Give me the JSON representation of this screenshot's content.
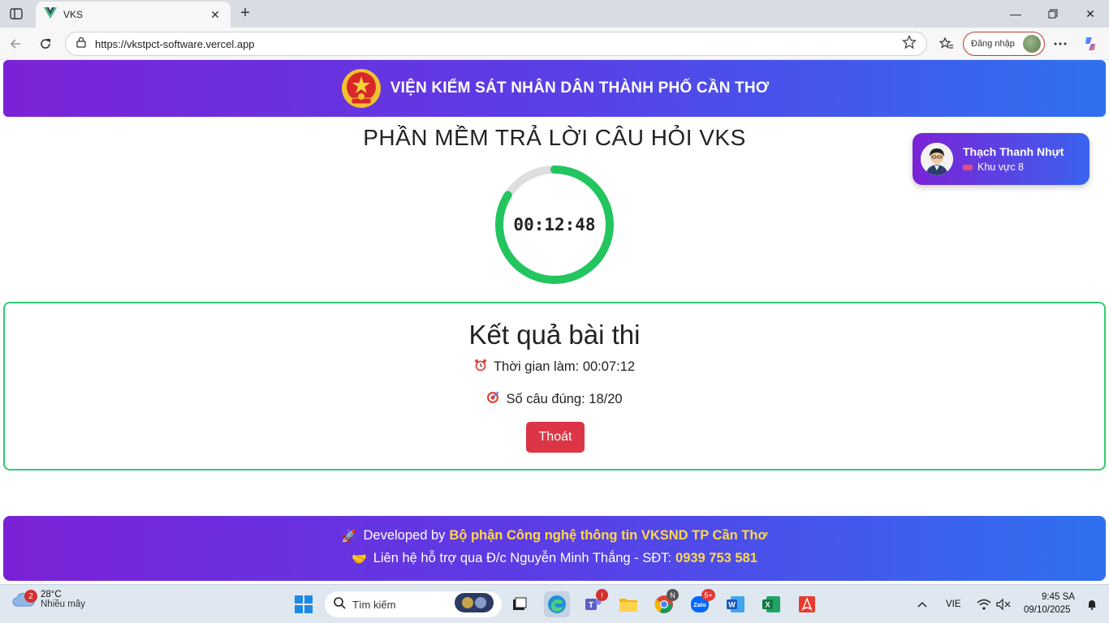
{
  "browser": {
    "tab_title": "VKS",
    "url": "https://vkstpct-software.vercel.app",
    "login_label": "Đăng nhập"
  },
  "header": {
    "title": "VIỆN KIỂM SÁT NHÂN DÂN THÀNH PHỐ CẦN THƠ"
  },
  "app": {
    "title": "PHẦN MỀM TRẢ LỜI CÂU HỎI VKS",
    "timer": "00:12:48",
    "timer_progress": 0.84
  },
  "user": {
    "name": "Thạch Thanh Nhựt",
    "area": "Khu vực 8"
  },
  "result": {
    "title": "Kết quả bài thi",
    "time_label": "Thời gian làm: 00:07:12",
    "score_label": "Số câu đúng: 18/20",
    "exit_label": "Thoát"
  },
  "footer": {
    "line1_prefix": "Developed by",
    "line1_highlight": "Bộ phận Công nghệ thông tin VKSND TP Cần Thơ",
    "line2_prefix": "Liên hệ hỗ trợ qua Đ/c Nguyễn Minh Thắng - SĐT:",
    "line2_highlight": "0939 753 581"
  },
  "taskbar": {
    "weather_badge": "2",
    "temperature": "28°C",
    "weather_desc": "Nhiều mây",
    "search_placeholder": "Tìm kiếm",
    "teams_badge": "!",
    "chrome_badge": "N",
    "zalo_badge": "5+",
    "language": "VIE",
    "time": "9:45 SA",
    "date": "09/10/2025"
  },
  "colors": {
    "header_gradient_start": "#7b22d6",
    "header_gradient_end": "#2f70f0",
    "timer_ring": "#22c55e",
    "result_border": "#2ecc71",
    "exit_button": "#dc3545",
    "footer_highlight": "#ffd84a"
  }
}
